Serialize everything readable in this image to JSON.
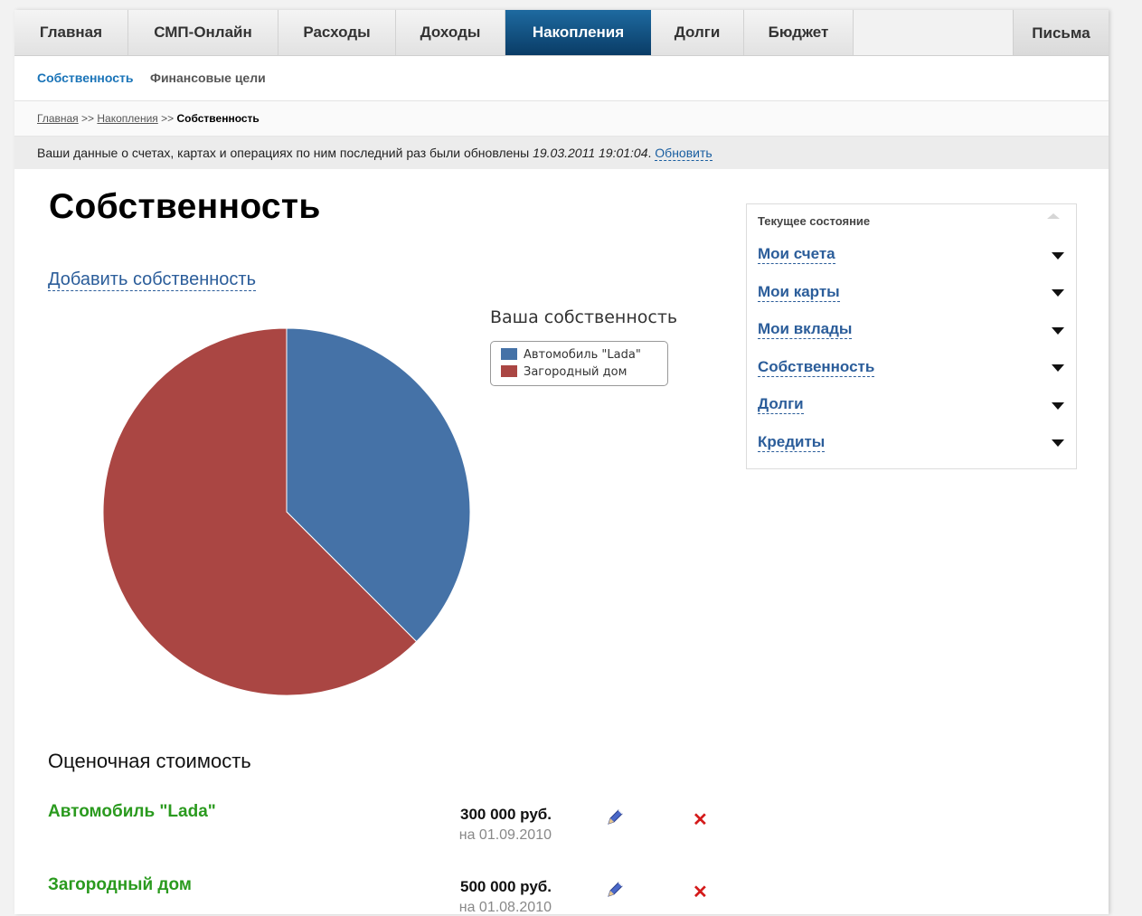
{
  "nav": {
    "tabs": [
      {
        "label": "Главная"
      },
      {
        "label": "СМП-Онлайн"
      },
      {
        "label": "Расходы"
      },
      {
        "label": "Доходы"
      },
      {
        "label": "Накопления",
        "active": true
      },
      {
        "label": "Долги"
      },
      {
        "label": "Бюджет"
      }
    ],
    "letters": "Письма"
  },
  "subnav": {
    "items": [
      "Собственность",
      "Финансовые цели"
    ]
  },
  "breadcrumb": {
    "home": "Главная",
    "sep1": ">>",
    "savings": "Накопления",
    "sep2": ">>",
    "current": "Собственность"
  },
  "update": {
    "text": "Ваши данные о счетах, картах и операциях по ним последний раз были обновлены ",
    "datetime": "19.03.2011 19:01:04",
    "dot": ". ",
    "refresh": "Обновить"
  },
  "page_title": "Собственность",
  "add_link": "Добавить собственность",
  "chart_data": {
    "type": "pie",
    "title": "Ваша собственность",
    "categories": [
      "Автомобиль \"Lada\"",
      "Загородный дом"
    ],
    "values": [
      300000,
      500000
    ],
    "colors": [
      "#4572a7",
      "#aa4643"
    ],
    "legend": "top-right"
  },
  "panel": {
    "title": "Текущее состояние",
    "items": [
      "Мои счета",
      "Мои карты",
      "Мои вклады",
      "Собственность",
      "Долги",
      "Кредиты"
    ]
  },
  "valuation": {
    "title": "Оценочная стоимость",
    "items": [
      {
        "name": "Автомобиль \"Lada\"",
        "amount": "300 000 руб.",
        "date": "на 01.09.2010"
      },
      {
        "name": "Загородный дом",
        "amount": "500 000 руб.",
        "date": "на 01.08.2010"
      }
    ]
  }
}
